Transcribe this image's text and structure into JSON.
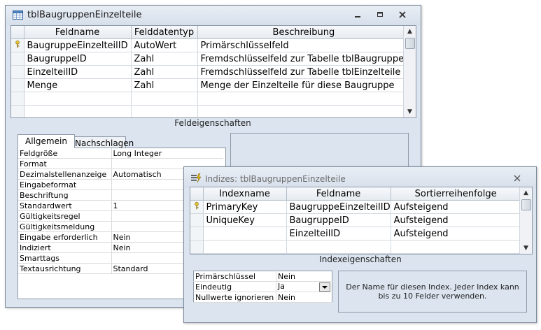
{
  "table_window": {
    "title": "tblBaugruppenEinzelteile",
    "columns": [
      "Feldname",
      "Felddatentyp",
      "Beschreibung"
    ],
    "rows": [
      {
        "key": true,
        "name": "BaugruppeEinzelteilID",
        "type": "AutoWert",
        "desc": "Primärschlüsselfeld"
      },
      {
        "key": false,
        "name": "BaugruppeID",
        "type": "Zahl",
        "desc": "Fremdschlüsselfeld zur Tabelle tblBaugruppen"
      },
      {
        "key": false,
        "name": "EinzelteilID",
        "type": "Zahl",
        "desc": "Fremdschlüsselfeld zur Tabelle tblEinzelteile"
      },
      {
        "key": false,
        "name": "Menge",
        "type": "Zahl",
        "desc": "Menge der Einzelteile für diese Baugruppe"
      }
    ],
    "properties_label": "Feldeigenschaften",
    "tabs": [
      "Allgemein",
      "Nachschlagen"
    ],
    "properties": [
      {
        "label": "Feldgröße",
        "value": "Long Integer"
      },
      {
        "label": "Format",
        "value": ""
      },
      {
        "label": "Dezimalstellenanzeige",
        "value": "Automatisch"
      },
      {
        "label": "Eingabeformat",
        "value": ""
      },
      {
        "label": "Beschriftung",
        "value": ""
      },
      {
        "label": "Standardwert",
        "value": "1"
      },
      {
        "label": "Gültigkeitsregel",
        "value": ""
      },
      {
        "label": "Gültigkeitsmeldung",
        "value": ""
      },
      {
        "label": "Eingabe erforderlich",
        "value": "Nein"
      },
      {
        "label": "Indiziert",
        "value": "Nein"
      },
      {
        "label": "Smarttags",
        "value": ""
      },
      {
        "label": "Textausrichtung",
        "value": "Standard"
      }
    ]
  },
  "index_window": {
    "title": "Indizes: tblBaugruppenEinzelteile",
    "columns": [
      "Indexname",
      "Feldname",
      "Sortierreihenfolge"
    ],
    "rows": [
      {
        "key": true,
        "index": "PrimaryKey",
        "field": "BaugruppeEinzelteilID",
        "sort": "Aufsteigend"
      },
      {
        "key": false,
        "index": "UniqueKey",
        "field": "BaugruppeID",
        "sort": "Aufsteigend"
      },
      {
        "key": false,
        "index": "",
        "field": "EinzelteilID",
        "sort": "Aufsteigend"
      }
    ],
    "properties_label": "Indexeigenschaften",
    "properties": [
      {
        "label": "Primärschlüssel",
        "value": "Nein"
      },
      {
        "label": "Eindeutig",
        "value": "Ja"
      },
      {
        "label": "Nullwerte ignorieren",
        "value": "Nein"
      }
    ],
    "help_text": "Der Name für diesen Index. Jeder Index kann bis zu 10 Felder verwenden."
  }
}
